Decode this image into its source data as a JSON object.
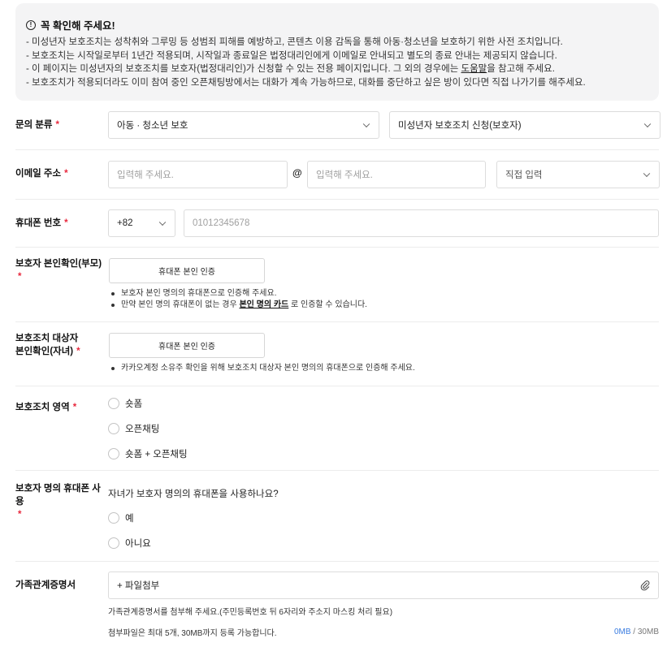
{
  "notice": {
    "title": "꼭 확인해 주세요!",
    "lines": [
      "- 미성년자 보호조치는 성착취와 그루밍 등 성범죄 피해를 예방하고, 콘텐츠 이용 감독을 통해 아동·청소년을 보호하기 위한 사전 조치입니다.",
      "- 보호조치는 시작일로부터 1년간 적용되며, 시작일과 종료일은 법정대리인에게 이메일로 안내되고 별도의 종료 안내는 제공되지 않습니다.",
      "- 보호조치가 적용되더라도 이미 참여 중인 오픈채팅방에서는 대화가 계속 가능하므로, 대화를 중단하고 싶은 방이 있다면 직접 나가기를 해주세요."
    ],
    "line3_pre": "- 이 페이지는 미성년자의 보호조치를 보호자(법정대리인)가 신청할 수 있는 전용 페이지입니다. 그 외의 경우에는 ",
    "line3_link": "도움말",
    "line3_post": "을 참고해 주세요."
  },
  "category": {
    "label": "문의 분류",
    "required": "*",
    "select1": "아동 · 청소년 보호",
    "select2": "미성년자 보호조치 신청(보호자)"
  },
  "email": {
    "label": "이메일 주소",
    "required": "*",
    "local_placeholder": "입력해 주세요.",
    "at": "@",
    "domain_placeholder": "입력해 주세요.",
    "domain_select": "직접 입력"
  },
  "phone": {
    "label": "휴대폰 번호",
    "required": "*",
    "country_code": "+82",
    "placeholder": "01012345678"
  },
  "guardian_verify": {
    "label": "보호자 본인확인(부모)",
    "required": "*",
    "button": "휴대폰 본인 인증",
    "bullet1": "보호자 본인 명의의 휴대폰으로 인증해 주세요.",
    "bullet2_pre": "만약 본인 명의 휴대폰이 없는 경우 ",
    "bullet2_link": "본인 명의 카드",
    "bullet2_post": " 로 인증할 수 있습니다."
  },
  "child_verify": {
    "label_line1": "보호조치 대상자",
    "label_line2": "본인확인(자녀)",
    "required": "*",
    "button": "휴대폰 본인 인증",
    "bullet1": "카카오계정 소유주 확인을 위해 보호조치 대상자 본인 명의의 휴대폰으로 인증해 주세요."
  },
  "scope": {
    "label": "보호조치 영역",
    "required": "*",
    "options": [
      "숏폼",
      "오픈채팅",
      "숏폼 + 오픈채팅"
    ]
  },
  "guardian_phone": {
    "label": "보호자 명의 휴대폰 사용",
    "required": "*",
    "question": "자녀가 보호자 명의의 휴대폰을 사용하나요?",
    "options": [
      "예",
      "아니요"
    ]
  },
  "family_cert": {
    "label": "가족관계증명서",
    "attach": "+ 파일첨부",
    "help": "가족관계증명서를 첨부해 주세요.(주민등록번호 뒤 6자리와 주소지 마스킹 처리 필요)",
    "limit": "첨부파일은 최대 5개, 30MB까지 등록 가능합니다.",
    "used": "0MB",
    "total": " / 30MB"
  }
}
